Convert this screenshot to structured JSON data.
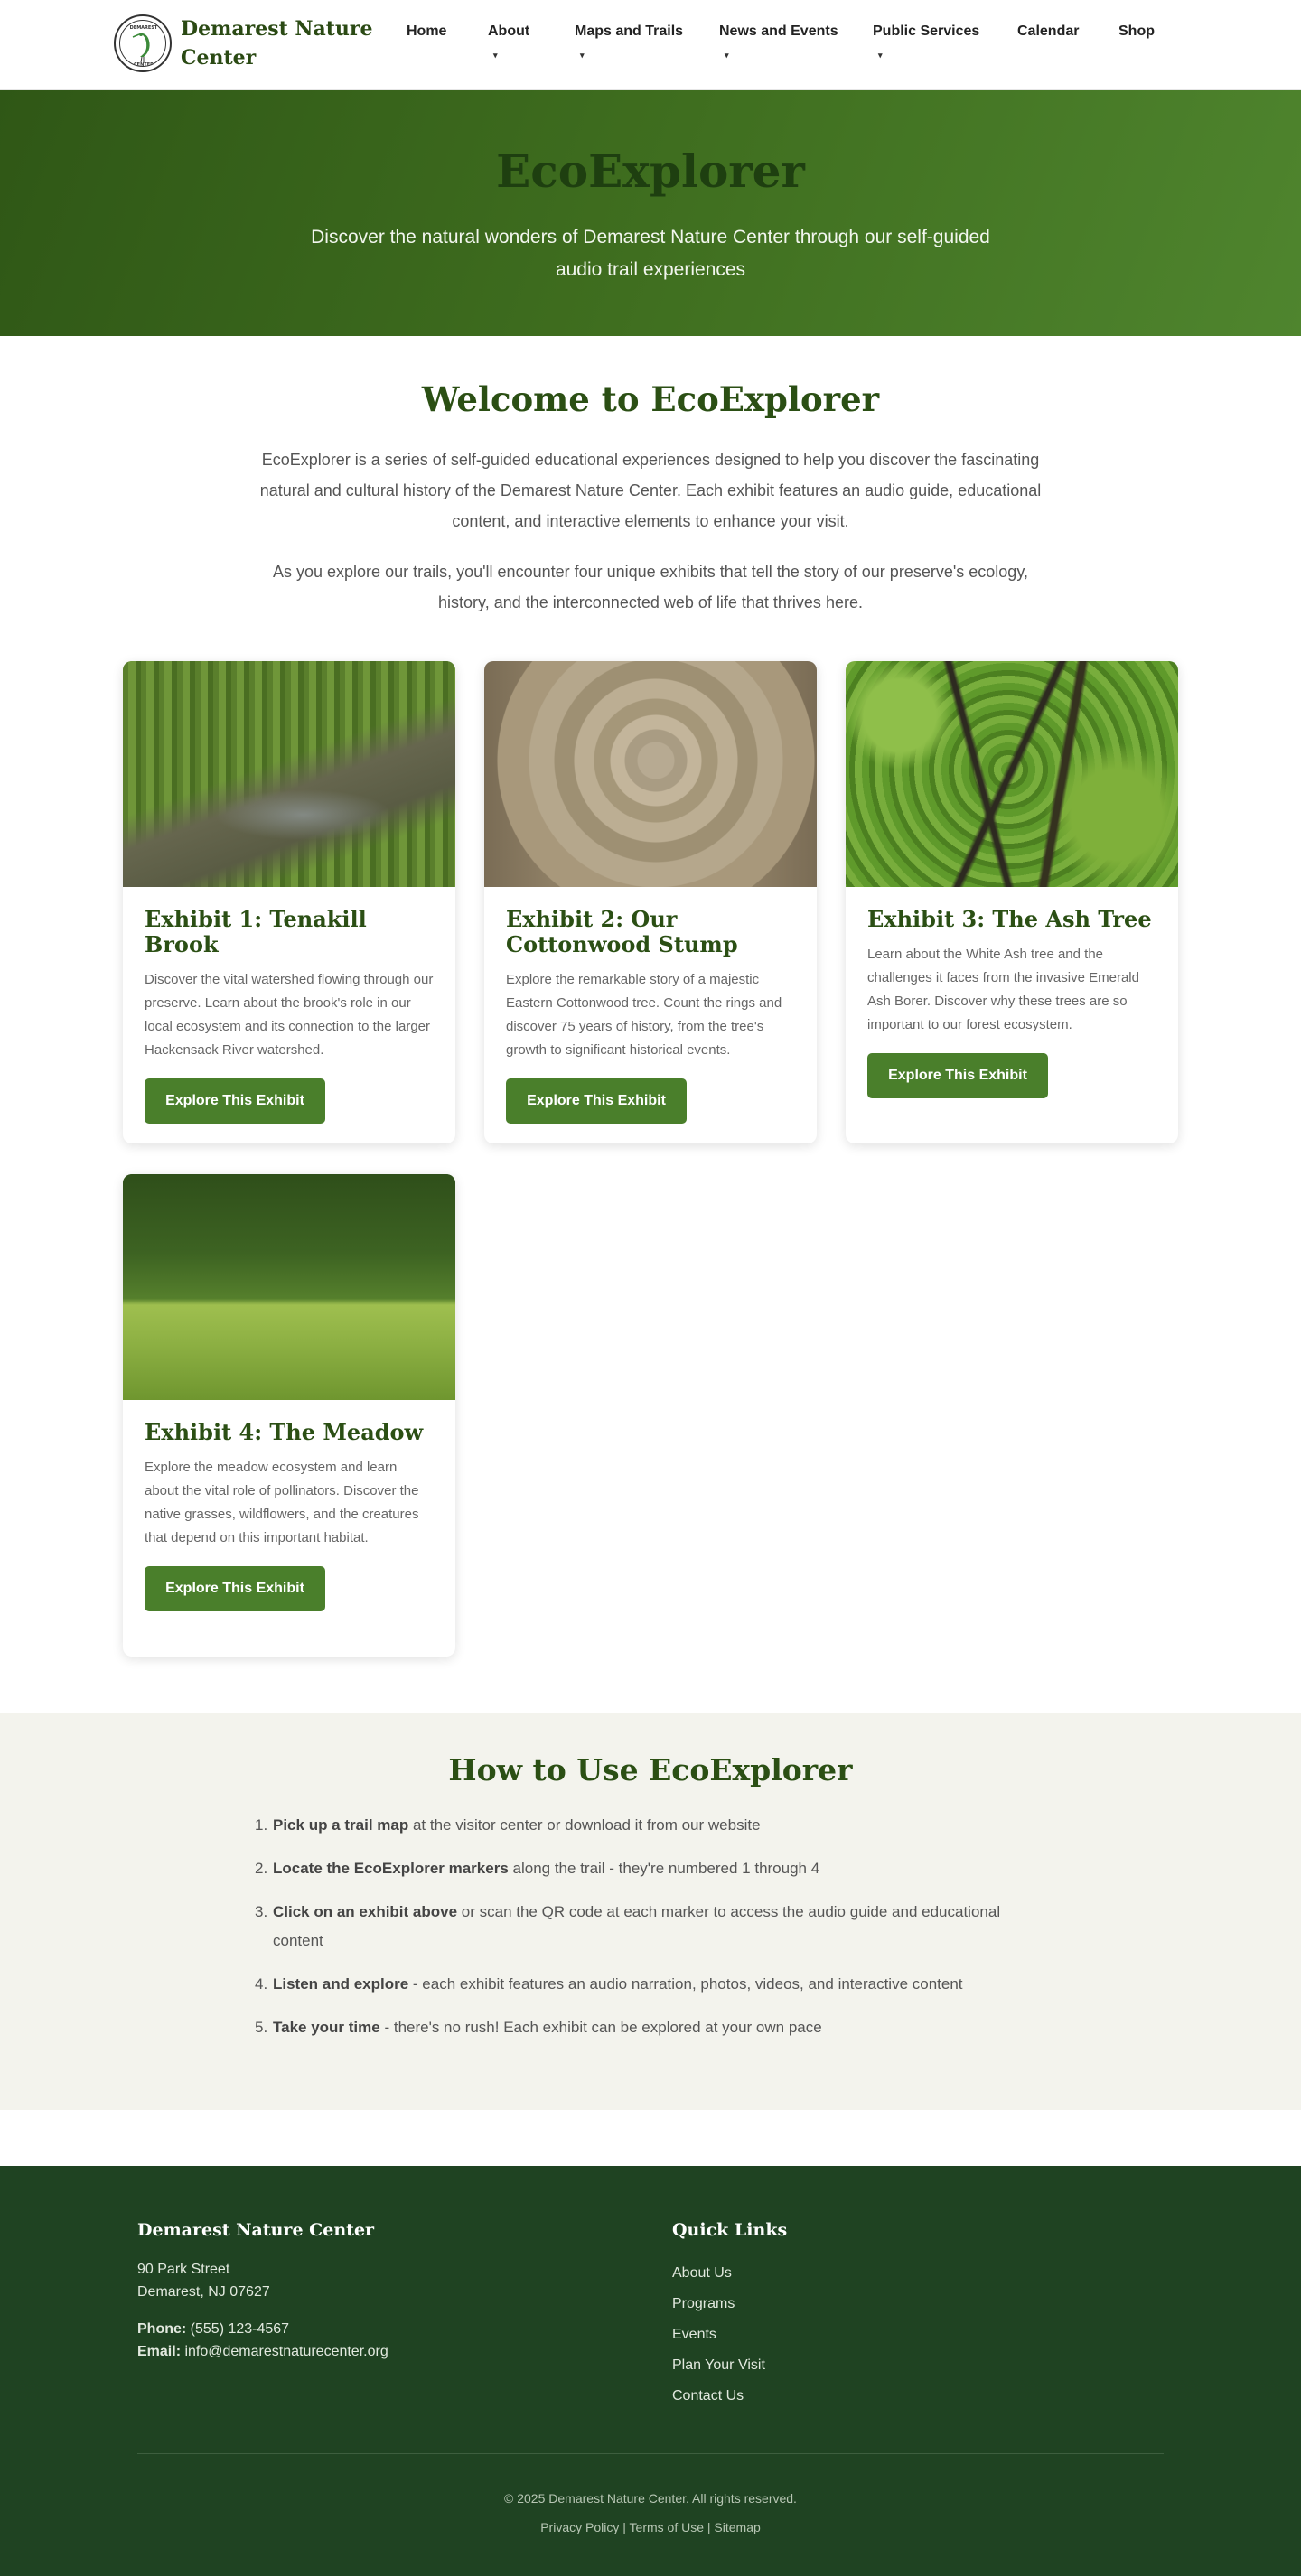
{
  "header": {
    "brand_line1": "Demarest Nature",
    "brand_line2": "Center",
    "nav": [
      {
        "label": "Home"
      },
      {
        "label": "About"
      },
      {
        "label": "Maps and Trails"
      },
      {
        "label": "News and Events"
      },
      {
        "label": "Public Services"
      },
      {
        "label": "Calendar"
      },
      {
        "label": "Shop"
      }
    ]
  },
  "hero": {
    "title": "EcoExplorer",
    "subtitle": "Discover the natural wonders of Demarest Nature Center through our self-guided audio trail experiences"
  },
  "welcome": {
    "title": "Welcome to EcoExplorer",
    "paragraph1": "EcoExplorer is a series of self-guided educational experiences designed to help you discover the fascinating natural and cultural history of the Demarest Nature Center. Each exhibit features an audio guide, educational content, and interactive elements to enhance your visit.",
    "paragraph2": "As you explore our trails, you'll encounter four unique exhibits that tell the story of our preserve's ecology, history, and the interconnected web of life that thrives here."
  },
  "exhibits": [
    {
      "title": "Exhibit 1: Tenakill Brook",
      "description": "Discover the vital watershed flowing through our preserve. Learn about the brook's role in our local ecosystem and its connection to the larger Hackensack River watershed.",
      "button": "Explore This Exhibit"
    },
    {
      "title": "Exhibit 2: Our Cottonwood Stump",
      "description": "Explore the remarkable story of a majestic Eastern Cottonwood tree. Count the rings and discover 75 years of history, from the tree's growth to significant historical events.",
      "button": "Explore This Exhibit"
    },
    {
      "title": "Exhibit 3: The Ash Tree",
      "description": "Learn about the White Ash tree and the challenges it faces from the invasive Emerald Ash Borer. Discover why these trees are so important to our forest ecosystem.",
      "button": "Explore This Exhibit"
    },
    {
      "title": "Exhibit 4: The Meadow",
      "description": "Explore the meadow ecosystem and learn about the vital role of pollinators. Discover the native grasses, wildflowers, and the creatures that depend on this important habitat.",
      "button": "Explore This Exhibit"
    }
  ],
  "howto": {
    "title": "How to Use EcoExplorer",
    "steps": [
      {
        "num": "1.",
        "bold": "Pick up a trail map",
        "text": " at the visitor center or download it from our website"
      },
      {
        "num": "2.",
        "bold": "Locate the EcoExplorer markers",
        "text": " along the trail - they're numbered 1 through 4"
      },
      {
        "num": "3.",
        "bold": "Click on an exhibit above",
        "text": " or scan the QR code at each marker to access the audio guide and educational content"
      },
      {
        "num": "4.",
        "bold": "Listen and explore",
        "text": " - each exhibit features an audio narration, photos, videos, and interactive content"
      },
      {
        "num": "5.",
        "bold": "Take your time",
        "text": " - there's no rush! Each exhibit can be explored at your own pace"
      }
    ]
  },
  "footer": {
    "org_title": "Demarest Nature Center",
    "address1": "90 Park Street",
    "address2": "Demarest, NJ 07627",
    "phone_label": "Phone:",
    "phone": " (555) 123-4567",
    "email_label": "Email:",
    "email": " info@demarestnaturecenter.org",
    "links_title": "Quick Links",
    "links": [
      "About Us",
      "Programs",
      "Events",
      "Plan Your Visit",
      "Contact Us"
    ],
    "copyright": "© 2025 Demarest Nature Center. All rights reserved.",
    "legal": [
      "Privacy Policy",
      "Terms of Use",
      "Sitemap"
    ],
    "legal_sep": " | "
  },
  "colors": {
    "brand_green": "#2b4f14",
    "button_green": "#4a7f2b",
    "footer_bg": "#1f4322",
    "howto_bg": "#f3f3ed"
  },
  "icons": {
    "logo": "heron-logo-icon",
    "dropdown": "caret-down-icon"
  }
}
